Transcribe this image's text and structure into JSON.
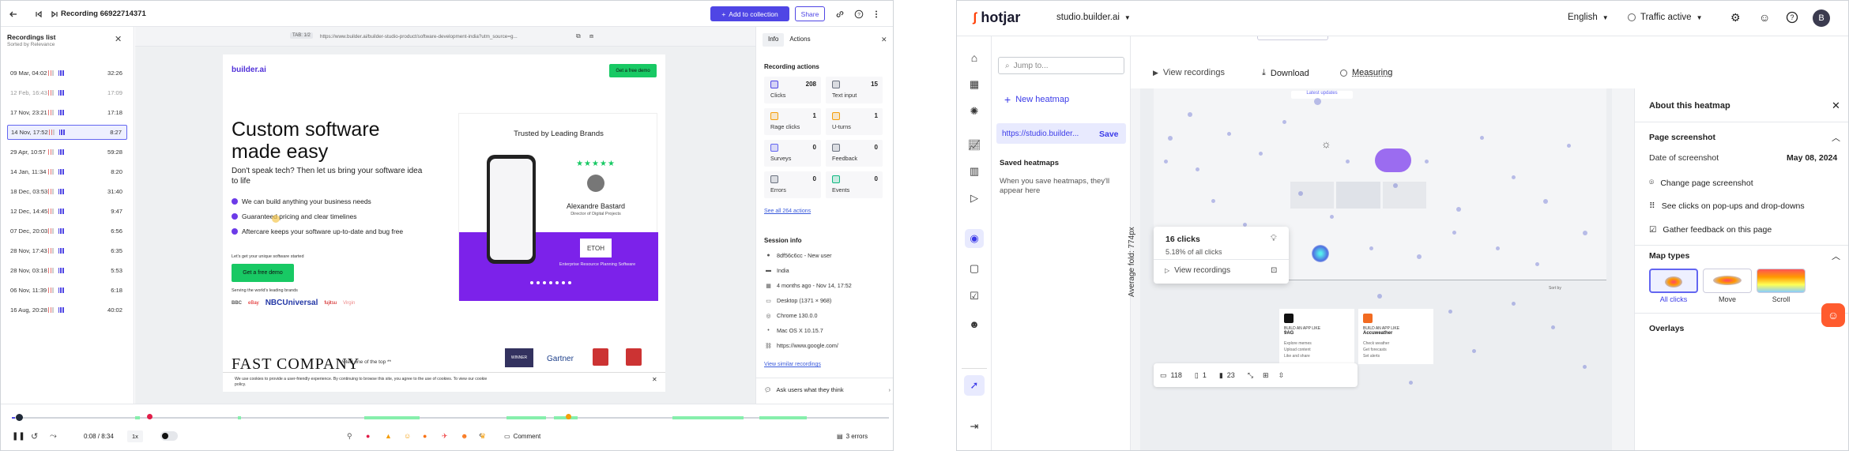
{
  "recording": {
    "title": "Recording 66922714371",
    "add_to_collection": "Add to collection",
    "share": "Share"
  },
  "recordings_list": {
    "title": "Recordings list",
    "subtitle": "Sorted by Relevance",
    "rows": [
      {
        "date": "09 Mar, 04:02",
        "duration": "32:26",
        "dim": false,
        "selected": false
      },
      {
        "date": "12 Feb, 16:43",
        "duration": "17:09",
        "dim": true,
        "selected": false
      },
      {
        "date": "17 Nov, 23:21",
        "duration": "17:18",
        "dim": false,
        "selected": false
      },
      {
        "date": "14 Nov, 17:52",
        "duration": "8:27",
        "dim": false,
        "selected": true
      },
      {
        "date": "29 Apr, 10:57",
        "duration": "59:28",
        "dim": false,
        "selected": false
      },
      {
        "date": "14 Jan, 11:34",
        "duration": "8:20",
        "dim": false,
        "selected": false
      },
      {
        "date": "18 Dec, 03:53",
        "duration": "31:40",
        "dim": false,
        "selected": false
      },
      {
        "date": "12 Dec, 14:45",
        "duration": "9:47",
        "dim": false,
        "selected": false
      },
      {
        "date": "07 Dec, 20:03",
        "duration": "6:56",
        "dim": false,
        "selected": false
      },
      {
        "date": "28 Nov, 17:43",
        "duration": "6:35",
        "dim": false,
        "selected": false
      },
      {
        "date": "28 Nov, 03:18",
        "duration": "5:53",
        "dim": false,
        "selected": false
      },
      {
        "date": "06 Nov, 11:39",
        "duration": "6:18",
        "dim": false,
        "selected": false
      },
      {
        "date": "16 Aug, 20:28",
        "duration": "40:02",
        "dim": false,
        "selected": false
      }
    ]
  },
  "preview": {
    "tab": "TAB: 1/2",
    "url": "https://www.builder.ai/builder-studio-product/software-development-india?utm_source=g..."
  },
  "site": {
    "logo": "builder.ai",
    "header_cta": "Get a free demo",
    "headline": "Custom software made easy",
    "subhead": "Don't speak tech? Then let us bring your software idea to life",
    "bullets": [
      "We can build anything your business needs",
      "Guaranteed pricing and clear timelines",
      "Aftercare keeps your software up-to-date and bug free"
    ],
    "small_label": "Let's get your unique software started",
    "cta": "Get a free demo",
    "trusted_label": "Serving the world's leading brands",
    "brands": [
      "BBC",
      "eBay",
      "NBCUniversal",
      "fujitsu",
      "Virgin"
    ],
    "trusted_by": "Trusted by Leading Brands",
    "person_name": "Alexandre Bastard",
    "person_role": "Director of Digital Projects",
    "erp_badge": "ETOH",
    "erp_caption": "Enterprise Resource Planning Software",
    "fastco": "FAST COMPANY",
    "voted": "Voted one of the top **",
    "gartner": "Gartner",
    "winner": "WINNER",
    "cookie": "We use cookies to provide a user-friendly experience. By continuing to browse this site, you agree to the use of cookies. To view our cookie policy."
  },
  "info_panel": {
    "tabs": [
      "Info",
      "Actions"
    ],
    "actions_title": "Recording actions",
    "stats": [
      {
        "label": "Clicks",
        "value": "208",
        "color": "#4f46e5"
      },
      {
        "label": "Text input",
        "value": "15",
        "color": "#6b7280"
      },
      {
        "label": "Rage clicks",
        "value": "1",
        "color": "#f59e0b"
      },
      {
        "label": "U-turns",
        "value": "1",
        "color": "#f59e0b"
      },
      {
        "label": "Surveys",
        "value": "0",
        "color": "#6366f1"
      },
      {
        "label": "Feedback",
        "value": "0",
        "color": "#6b7280"
      },
      {
        "label": "Errors",
        "value": "0",
        "color": "#6b7280"
      },
      {
        "label": "Events",
        "value": "0",
        "color": "#10b981"
      }
    ],
    "see_all": "See all 264 actions",
    "session_title": "Session info",
    "session": [
      {
        "icon": "user-icon",
        "text": "8df56c6cc - New user"
      },
      {
        "icon": "flag-icon",
        "text": "India"
      },
      {
        "icon": "calendar-icon",
        "text": "4 months ago - Nov 14, 17:52"
      },
      {
        "icon": "desktop-icon",
        "text": "Desktop (1371 × 968)"
      },
      {
        "icon": "chrome-icon",
        "text": "Chrome 130.0.0"
      },
      {
        "icon": "apple-icon",
        "text": "Mac OS X 10.15.7"
      },
      {
        "icon": "link-icon",
        "text": "https://www.google.com/"
      }
    ],
    "similar": "View similar recordings",
    "ask": "Ask users what they think"
  },
  "player": {
    "time": "0:08 / 8:34",
    "speed": "1x",
    "comment": "Comment",
    "errors": "3 errors"
  },
  "hotjar": {
    "brand": "hotjar",
    "site": "studio.builder.ai",
    "language": "English",
    "traffic": "Traffic active",
    "avatar": "B",
    "jump_placeholder": "Jump to...",
    "new_heatmap": "New heatmap",
    "active_url": "https://studio.builder...",
    "save": "Save",
    "saved_title": "Saved heatmaps",
    "saved_empty": "When you save heatmaps, they'll appear here",
    "view_recordings": "View recordings",
    "download": "Download",
    "measuring": "Measuring",
    "fold_label": "Average fold: 774px",
    "latest_label": "Latest updates",
    "clicks_title": "16 clicks",
    "clicks_sub": "5.18% of all clicks",
    "clicks_view": "View recordings",
    "bottom_stats": [
      "118",
      "1",
      "23"
    ],
    "sort_label": "Sort by",
    "app_cards": [
      {
        "title": "BUILD AN APP LIKE",
        "name": "9AG",
        "items": [
          "Explore memes",
          "Upload content",
          "Like and share"
        ]
      },
      {
        "title": "BUILD AN APP LIKE",
        "name": "Accuweather",
        "items": [
          "Check weather",
          "Get forecasts",
          "Set alerts"
        ]
      }
    ],
    "about": {
      "title": "About this heatmap",
      "page_screenshot": "Page screenshot",
      "date_label": "Date of screenshot",
      "date_value": "May 08, 2024",
      "change": "Change page screenshot",
      "see_clicks": "See clicks on pop-ups and drop-downs",
      "gather": "Gather feedback on this page",
      "map_types": "Map types",
      "types": [
        "All clicks",
        "Move",
        "Scroll"
      ],
      "overlays": "Overlays"
    }
  }
}
